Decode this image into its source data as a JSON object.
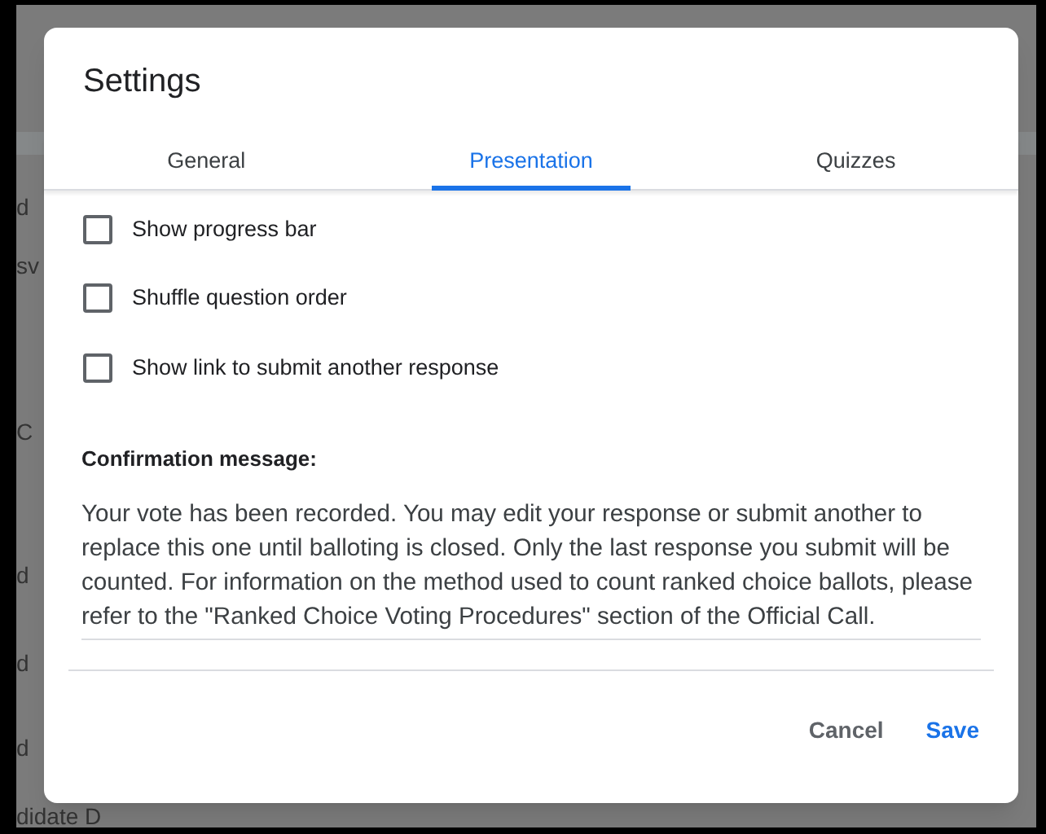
{
  "background_fragments": [
    {
      "text": "d"
    },
    {
      "text": "sv"
    },
    {
      "text": "C"
    },
    {
      "text": "d"
    },
    {
      "text": "d"
    },
    {
      "text": "d"
    },
    {
      "text": "didate D"
    }
  ],
  "dialog": {
    "title": "Settings",
    "tabs": [
      {
        "label": "General",
        "selected": false
      },
      {
        "label": "Presentation",
        "selected": true
      },
      {
        "label": "Quizzes",
        "selected": false
      }
    ],
    "options": [
      {
        "label": "Show progress bar",
        "checked": false
      },
      {
        "label": "Shuffle question order",
        "checked": false
      },
      {
        "label": "Show link to submit another response",
        "checked": false
      }
    ],
    "confirmation_label": "Confirmation message:",
    "confirmation_message": "Your vote has been recorded. You may edit your response or submit another to replace this one until balloting is closed. Only the last response you submit will be counted. For information on the method used to count ranked choice ballots, please refer to the \"Ranked Choice Voting Procedures\" section of the Official Call.",
    "buttons": [
      {
        "label": "Cancel",
        "kind": "secondary"
      },
      {
        "label": "Save",
        "kind": "primary"
      }
    ]
  }
}
